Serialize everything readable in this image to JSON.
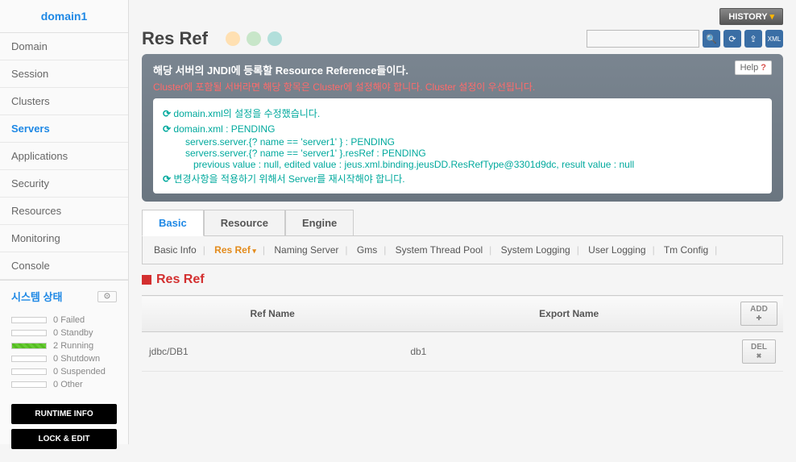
{
  "sidebar": {
    "domain_title": "domain1",
    "nav_items": [
      {
        "label": "Domain",
        "active": false
      },
      {
        "label": "Session",
        "active": false
      },
      {
        "label": "Clusters",
        "active": false
      },
      {
        "label": "Servers",
        "active": true
      },
      {
        "label": "Applications",
        "active": false
      },
      {
        "label": "Security",
        "active": false
      },
      {
        "label": "Resources",
        "active": false
      },
      {
        "label": "Monitoring",
        "active": false
      },
      {
        "label": "Console",
        "active": false
      }
    ],
    "system_status_title": "시스템 상태",
    "status_rows": [
      {
        "count": "0",
        "label": "Failed",
        "running": false
      },
      {
        "count": "0",
        "label": "Standby",
        "running": false
      },
      {
        "count": "2",
        "label": "Running",
        "running": true
      },
      {
        "count": "0",
        "label": "Shutdown",
        "running": false
      },
      {
        "count": "0",
        "label": "Suspended",
        "running": false
      },
      {
        "count": "0",
        "label": "Other",
        "running": false
      }
    ],
    "runtime_info_btn": "RUNTIME INFO",
    "lock_edit_btn": "LOCK & EDIT"
  },
  "topbar": {
    "history_label": "HISTORY"
  },
  "page": {
    "title": "Res Ref"
  },
  "msg": {
    "header": "해당 서버의 JNDI에 등록할 Resource Reference들이다.",
    "warning": "Cluster에 포함될 서버라면 해당 항목은 Cluster에 설정해야 합니다. Cluster 설정이 우선됩니다.",
    "line1": "domain.xml의 설정을 수정했습니다.",
    "line2": "domain.xml : PENDING",
    "line3": "servers.server.{? name == 'server1' } : PENDING",
    "line4": "servers.server.{? name == 'server1' }.resRef : PENDING",
    "line5": "previous value : null, edited value : jeus.xml.binding.jeusDD.ResRefType@3301d9dc, result value : null",
    "line6": "변경사항을 적용하기 위해서 Server를 재시작해야 합니다.",
    "help_label": "Help"
  },
  "tabs": {
    "basic": "Basic",
    "resource": "Resource",
    "engine": "Engine"
  },
  "subtabs": {
    "items": [
      "Basic Info",
      "Res Ref",
      "Naming Server",
      "Gms",
      "System Thread Pool",
      "System Logging",
      "User Logging",
      "Tm Config"
    ]
  },
  "section": {
    "title": "Res Ref"
  },
  "table": {
    "col_ref_name": "Ref Name",
    "col_export_name": "Export Name",
    "add_label": "ADD",
    "del_label": "DEL",
    "rows": [
      {
        "ref_name": "jdbc/DB1",
        "export_name": "db1"
      }
    ]
  }
}
